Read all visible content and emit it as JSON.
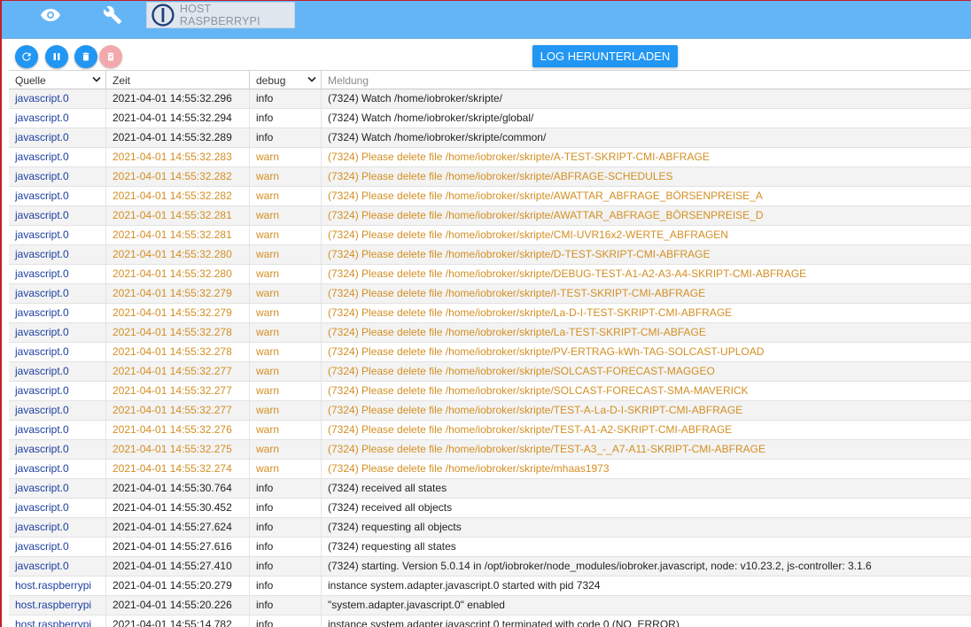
{
  "colors": {
    "topbar": "#64b5f6",
    "primary_button": "#2196f3",
    "disabled_button": "#f2a8ad",
    "source_text": "#1d3fa0",
    "warn_text": "#d38f23",
    "info_text": "#222222"
  },
  "topbar": {
    "icons": [
      "eye-icon",
      "wrench-icon"
    ],
    "host_tab_label": "HOST RASPBERRYPI"
  },
  "toolbar": {
    "buttons": [
      "refresh-icon",
      "pause-icon",
      "delete-icon",
      "delete-disabled-icon"
    ],
    "download_label": "LOG HERUNTERLADEN"
  },
  "table": {
    "headers": {
      "source": "Quelle",
      "time": "Zeit",
      "severity": "debug",
      "message_placeholder": "Meldung"
    },
    "rows": [
      {
        "source": "javascript.0",
        "time": "2021-04-01 14:55:32.296",
        "severity": "info",
        "message": "(7324) Watch /home/iobroker/skripte/"
      },
      {
        "source": "javascript.0",
        "time": "2021-04-01 14:55:32.294",
        "severity": "info",
        "message": "(7324) Watch /home/iobroker/skripte/global/"
      },
      {
        "source": "javascript.0",
        "time": "2021-04-01 14:55:32.289",
        "severity": "info",
        "message": "(7324) Watch /home/iobroker/skripte/common/"
      },
      {
        "source": "javascript.0",
        "time": "2021-04-01 14:55:32.283",
        "severity": "warn",
        "message": "(7324) Please delete file /home/iobroker/skripte/A-TEST-SKRIPT-CMI-ABFRAGE"
      },
      {
        "source": "javascript.0",
        "time": "2021-04-01 14:55:32.282",
        "severity": "warn",
        "message": "(7324) Please delete file /home/iobroker/skripte/ABFRAGE-SCHEDULES"
      },
      {
        "source": "javascript.0",
        "time": "2021-04-01 14:55:32.282",
        "severity": "warn",
        "message": "(7324) Please delete file /home/iobroker/skripte/AWATTAR_ABFRAGE_BÖRSENPREISE_A"
      },
      {
        "source": "javascript.0",
        "time": "2021-04-01 14:55:32.281",
        "severity": "warn",
        "message": "(7324) Please delete file /home/iobroker/skripte/AWATTAR_ABFRAGE_BÖRSENPREISE_D"
      },
      {
        "source": "javascript.0",
        "time": "2021-04-01 14:55:32.281",
        "severity": "warn",
        "message": "(7324) Please delete file /home/iobroker/skripte/CMI-UVR16x2-WERTE_ABFRAGEN"
      },
      {
        "source": "javascript.0",
        "time": "2021-04-01 14:55:32.280",
        "severity": "warn",
        "message": "(7324) Please delete file /home/iobroker/skripte/D-TEST-SKRIPT-CMI-ABFRAGE"
      },
      {
        "source": "javascript.0",
        "time": "2021-04-01 14:55:32.280",
        "severity": "warn",
        "message": "(7324) Please delete file /home/iobroker/skripte/DEBUG-TEST-A1-A2-A3-A4-SKRIPT-CMI-ABFRAGE"
      },
      {
        "source": "javascript.0",
        "time": "2021-04-01 14:55:32.279",
        "severity": "warn",
        "message": "(7324) Please delete file /home/iobroker/skripte/I-TEST-SKRIPT-CMI-ABFRAGE"
      },
      {
        "source": "javascript.0",
        "time": "2021-04-01 14:55:32.279",
        "severity": "warn",
        "message": "(7324) Please delete file /home/iobroker/skripte/La-D-I-TEST-SKRIPT-CMI-ABFRAGE"
      },
      {
        "source": "javascript.0",
        "time": "2021-04-01 14:55:32.278",
        "severity": "warn",
        "message": "(7324) Please delete file /home/iobroker/skripte/La-TEST-SKRIPT-CMI-ABFAGE"
      },
      {
        "source": "javascript.0",
        "time": "2021-04-01 14:55:32.278",
        "severity": "warn",
        "message": "(7324) Please delete file /home/iobroker/skripte/PV-ERTRAG-kWh-TAG-SOLCAST-UPLOAD"
      },
      {
        "source": "javascript.0",
        "time": "2021-04-01 14:55:32.277",
        "severity": "warn",
        "message": "(7324) Please delete file /home/iobroker/skripte/SOLCAST-FORECAST-MAGGEO"
      },
      {
        "source": "javascript.0",
        "time": "2021-04-01 14:55:32.277",
        "severity": "warn",
        "message": "(7324) Please delete file /home/iobroker/skripte/SOLCAST-FORECAST-SMA-MAVERICK"
      },
      {
        "source": "javascript.0",
        "time": "2021-04-01 14:55:32.277",
        "severity": "warn",
        "message": "(7324) Please delete file /home/iobroker/skripte/TEST-A-La-D-I-SKRIPT-CMI-ABFRAGE"
      },
      {
        "source": "javascript.0",
        "time": "2021-04-01 14:55:32.276",
        "severity": "warn",
        "message": "(7324) Please delete file /home/iobroker/skripte/TEST-A1-A2-SKRIPT-CMI-ABFRAGE"
      },
      {
        "source": "javascript.0",
        "time": "2021-04-01 14:55:32.275",
        "severity": "warn",
        "message": "(7324) Please delete file /home/iobroker/skripte/TEST-A3_-_A7-A11-SKRIPT-CMI-ABFRAGE"
      },
      {
        "source": "javascript.0",
        "time": "2021-04-01 14:55:32.274",
        "severity": "warn",
        "message": "(7324) Please delete file /home/iobroker/skripte/mhaas1973"
      },
      {
        "source": "javascript.0",
        "time": "2021-04-01 14:55:30.764",
        "severity": "info",
        "message": "(7324) received all states"
      },
      {
        "source": "javascript.0",
        "time": "2021-04-01 14:55:30.452",
        "severity": "info",
        "message": "(7324) received all objects"
      },
      {
        "source": "javascript.0",
        "time": "2021-04-01 14:55:27.624",
        "severity": "info",
        "message": "(7324) requesting all objects"
      },
      {
        "source": "javascript.0",
        "time": "2021-04-01 14:55:27.616",
        "severity": "info",
        "message": "(7324) requesting all states"
      },
      {
        "source": "javascript.0",
        "time": "2021-04-01 14:55:27.410",
        "severity": "info",
        "message": "(7324) starting. Version 5.0.14 in /opt/iobroker/node_modules/iobroker.javascript, node: v10.23.2, js-controller: 3.1.6"
      },
      {
        "source": "host.raspberrypi",
        "time": "2021-04-01 14:55:20.279",
        "severity": "info",
        "message": "instance system.adapter.javascript.0 started with pid 7324"
      },
      {
        "source": "host.raspberrypi",
        "time": "2021-04-01 14:55:20.226",
        "severity": "info",
        "message": "\"system.adapter.javascript.0\" enabled"
      },
      {
        "source": "host.raspberrypi",
        "time": "2021-04-01 14:55:14.782",
        "severity": "info",
        "message": "instance system.adapter.javascript.0 terminated with code 0 (NO_ERROR)"
      }
    ]
  }
}
